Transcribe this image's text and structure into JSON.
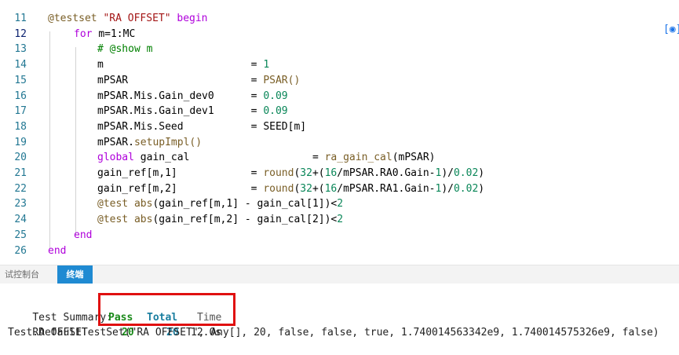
{
  "editor": {
    "lines": [
      {
        "n": "11",
        "code": [
          {
            "t": "@testset ",
            "c": "mac"
          },
          {
            "t": "\"RA OFFSET\"",
            "c": "str"
          },
          {
            "t": " begin",
            "c": "kw"
          }
        ],
        "indent": 0
      },
      {
        "n": "12",
        "code": [
          {
            "t": "for ",
            "c": "kw"
          },
          {
            "t": "m=1:MC",
            "c": "op"
          }
        ],
        "indent": 1,
        "current": true
      },
      {
        "n": "13",
        "code": [
          {
            "t": "# @show m",
            "c": "cmt"
          }
        ],
        "indent": 2
      },
      {
        "n": "14",
        "code": [
          {
            "t": "m                        ",
            "c": "op"
          },
          {
            "t": "= ",
            "c": "op"
          },
          {
            "t": "1",
            "c": "num"
          }
        ],
        "indent": 2
      },
      {
        "n": "15",
        "code": [
          {
            "t": "mPSAR                    ",
            "c": "op"
          },
          {
            "t": "= ",
            "c": "op"
          },
          {
            "t": "PSAR()",
            "c": "fn"
          }
        ],
        "indent": 2
      },
      {
        "n": "16",
        "code": [
          {
            "t": "mPSAR.Mis.Gain_dev0      ",
            "c": "op"
          },
          {
            "t": "= ",
            "c": "op"
          },
          {
            "t": "0.09",
            "c": "num"
          }
        ],
        "indent": 2
      },
      {
        "n": "17",
        "code": [
          {
            "t": "mPSAR.Mis.Gain_dev1      ",
            "c": "op"
          },
          {
            "t": "= ",
            "c": "op"
          },
          {
            "t": "0.09",
            "c": "num"
          }
        ],
        "indent": 2
      },
      {
        "n": "18",
        "code": [
          {
            "t": "mPSAR.Mis.Seed           ",
            "c": "op"
          },
          {
            "t": "= SEED[m]",
            "c": "op"
          }
        ],
        "indent": 2
      },
      {
        "n": "19",
        "code": [
          {
            "t": "mPSAR.",
            "c": "op"
          },
          {
            "t": "setupImpl()",
            "c": "fn"
          }
        ],
        "indent": 2
      },
      {
        "n": "20",
        "code": [
          {
            "t": "global ",
            "c": "kw"
          },
          {
            "t": "gain_cal                    ",
            "c": "op"
          },
          {
            "t": "= ",
            "c": "op"
          },
          {
            "t": "ra_gain_cal",
            "c": "fn"
          },
          {
            "t": "(mPSAR)",
            "c": "op"
          }
        ],
        "indent": 2
      },
      {
        "n": "21",
        "code": [
          {
            "t": "gain_ref[m,1]            ",
            "c": "op"
          },
          {
            "t": "= ",
            "c": "op"
          },
          {
            "t": "round",
            "c": "fn"
          },
          {
            "t": "(",
            "c": "op"
          },
          {
            "t": "32",
            "c": "num"
          },
          {
            "t": "+(",
            "c": "op"
          },
          {
            "t": "16",
            "c": "num"
          },
          {
            "t": "/mPSAR.RA0.Gain-",
            "c": "op"
          },
          {
            "t": "1",
            "c": "num"
          },
          {
            "t": ")/",
            "c": "op"
          },
          {
            "t": "0.02",
            "c": "num"
          },
          {
            "t": ")",
            "c": "op"
          }
        ],
        "indent": 2
      },
      {
        "n": "22",
        "code": [
          {
            "t": "gain_ref[m,2]            ",
            "c": "op"
          },
          {
            "t": "= ",
            "c": "op"
          },
          {
            "t": "round",
            "c": "fn"
          },
          {
            "t": "(",
            "c": "op"
          },
          {
            "t": "32",
            "c": "num"
          },
          {
            "t": "+(",
            "c": "op"
          },
          {
            "t": "16",
            "c": "num"
          },
          {
            "t": "/mPSAR.RA1.Gain-",
            "c": "op"
          },
          {
            "t": "1",
            "c": "num"
          },
          {
            "t": ")/",
            "c": "op"
          },
          {
            "t": "0.02",
            "c": "num"
          },
          {
            "t": ")",
            "c": "op"
          }
        ],
        "indent": 2
      },
      {
        "n": "23",
        "code": [
          {
            "t": "@test ",
            "c": "mac"
          },
          {
            "t": "abs",
            "c": "fn"
          },
          {
            "t": "(gain_ref[m,1] - gain_cal[1])<",
            "c": "op"
          },
          {
            "t": "2",
            "c": "num"
          }
        ],
        "indent": 2
      },
      {
        "n": "24",
        "code": [
          {
            "t": "@test ",
            "c": "mac"
          },
          {
            "t": "abs",
            "c": "fn"
          },
          {
            "t": "(gain_ref[m,2] - gain_cal[2])<",
            "c": "op"
          },
          {
            "t": "2",
            "c": "num"
          }
        ],
        "indent": 2
      },
      {
        "n": "25",
        "code": [
          {
            "t": "end",
            "c": "kw"
          }
        ],
        "indent": 1
      },
      {
        "n": "26",
        "code": [
          {
            "t": "end",
            "c": "kw"
          }
        ],
        "indent": 0
      }
    ],
    "focus_icon": "focus-icon"
  },
  "panel": {
    "tabs": [
      {
        "label": "调试控制台",
        "visible_label": "试控制台",
        "active": false
      },
      {
        "label": "终端",
        "active": true
      }
    ]
  },
  "terminal": {
    "summary_label": "Test Summary:",
    "pass_header": "Pass",
    "total_header": "Total",
    "time_header": "Time",
    "row_name": "RA OFFSET",
    "pass_value": "20",
    "total_value": "20",
    "time_value": "12.0s",
    "result_line": "Test.DefaultTestSet(\"RA OFFSET\", Any[], 20, false, false, true, 1.740014563342e9, 1.740014575326e9, false)"
  },
  "colors": {
    "highlight_box": "#e01010",
    "active_tab": "#1f8ad2",
    "keyword": "#af00db",
    "string": "#a31515",
    "number": "#098658",
    "comment": "#008000"
  }
}
